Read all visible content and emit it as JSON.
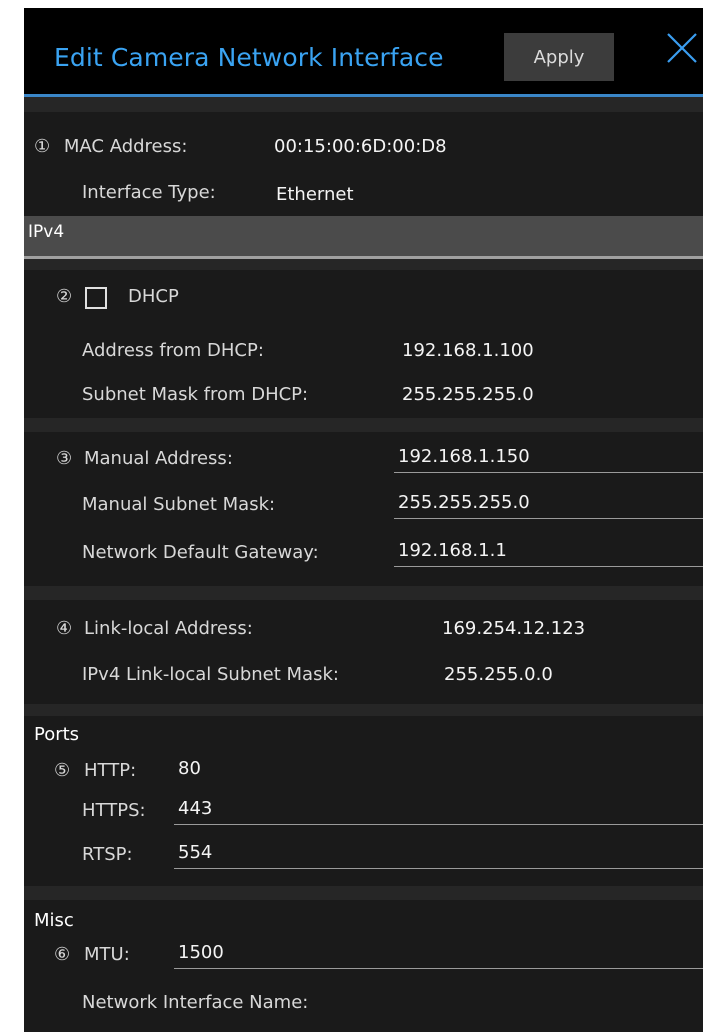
{
  "window": {
    "title": "Edit Camera Network Interface",
    "apply_label": "Apply",
    "close_icon": "close-icon",
    "accent_color": "#3aa3f2"
  },
  "identity": {
    "num": "①",
    "mac_label": "MAC Address:",
    "mac_value": "00:15:00:6D:00:D8",
    "type_label": "Interface Type:",
    "type_value": "Ethernet"
  },
  "ipv4_header": "IPv4",
  "dhcp": {
    "num": "②",
    "checkbox_label": "DHCP",
    "checked": false,
    "address_label": "Address from DHCP:",
    "address_value": "192.168.1.100",
    "mask_label": "Subnet Mask from DHCP:",
    "mask_value": "255.255.255.0"
  },
  "manual": {
    "num": "③",
    "address_label": "Manual Address:",
    "address_value": "192.168.1.150",
    "mask_label": "Manual Subnet Mask:",
    "mask_value": "255.255.255.0",
    "gateway_label": "Network Default Gateway:",
    "gateway_value": "192.168.1.1"
  },
  "link_local": {
    "num": "④",
    "address_label": "Link-local Address:",
    "address_value": "169.254.12.123",
    "mask_label": "IPv4 Link-local Subnet Mask:",
    "mask_value": "255.255.0.0"
  },
  "ports": {
    "header": "Ports",
    "num": "⑤",
    "http_label": "HTTP:",
    "http_value": "80",
    "https_label": "HTTPS:",
    "https_value": "443",
    "rtsp_label": "RTSP:",
    "rtsp_value": "554"
  },
  "misc": {
    "header": "Misc",
    "num": "⑥",
    "mtu_label": "MTU:",
    "mtu_value": "1500",
    "name_label": "Network Interface Name:"
  }
}
